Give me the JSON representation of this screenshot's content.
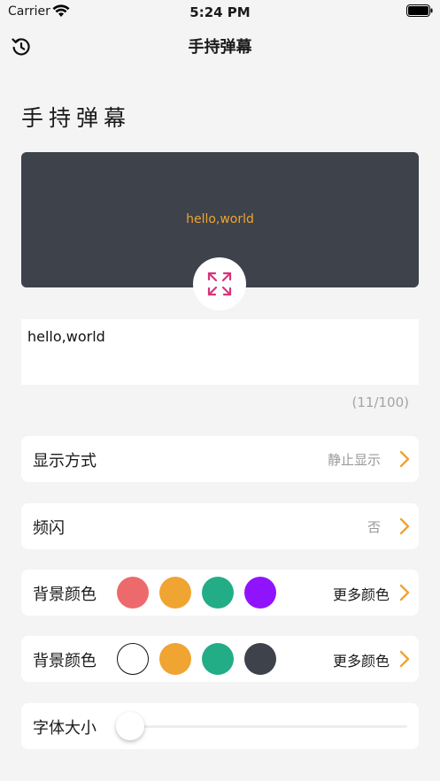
{
  "status_bar": {
    "carrier": "Carrier",
    "time": "5:24 PM"
  },
  "nav": {
    "title": "手持弹幕",
    "left_icon": "history-icon"
  },
  "page": {
    "heading": "手持弹幕"
  },
  "preview": {
    "text": "hello,world",
    "text_color": "#f0a431",
    "background": "#3d424b",
    "fullscreen_icon": "expand-icon",
    "icon_color": "#d7337c"
  },
  "input": {
    "value": "hello,world",
    "count": "(11/100)"
  },
  "display_mode": {
    "label": "显示方式",
    "value": "静止显示"
  },
  "flash": {
    "label": "频闪",
    "value": "否"
  },
  "background_colors": {
    "label": "背景颜色",
    "more": "更多颜色",
    "swatches": [
      "#ec6a6b",
      "#f0a431",
      "#22ad87",
      "#9013fe"
    ]
  },
  "text_colors": {
    "label": "背景颜色",
    "more": "更多颜色",
    "swatches": [
      "#ffffff",
      "#f0a431",
      "#22ad87",
      "#3d424b"
    ]
  },
  "font_size": {
    "label": "字体大小",
    "slider_value": 0
  },
  "accent": "#f0a431"
}
